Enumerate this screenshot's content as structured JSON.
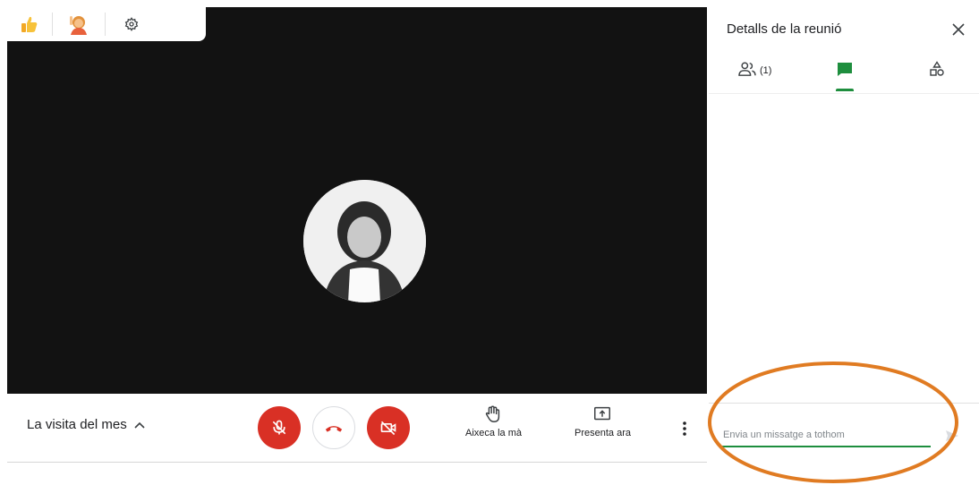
{
  "reactions": {
    "thumbs_up_icon": "thumbs-up-icon",
    "raise_hand_icon": "raised-hand-person-icon",
    "settings_icon": "gear-icon"
  },
  "meeting": {
    "title": "La visita del mes"
  },
  "controls": {
    "raise_hand_label": "Aixeca la mà",
    "present_label": "Presenta ara",
    "mic_state": "muted",
    "camera_state": "off"
  },
  "panel": {
    "title": "Detalls de la reunió",
    "people_count": "(1)",
    "active_tab": "chat",
    "chat_placeholder": "Envia un missatge a tothom"
  },
  "colors": {
    "accent": "#1e8e3e",
    "danger": "#d93025",
    "highlight": "#e07b22",
    "stage": "#121212"
  }
}
